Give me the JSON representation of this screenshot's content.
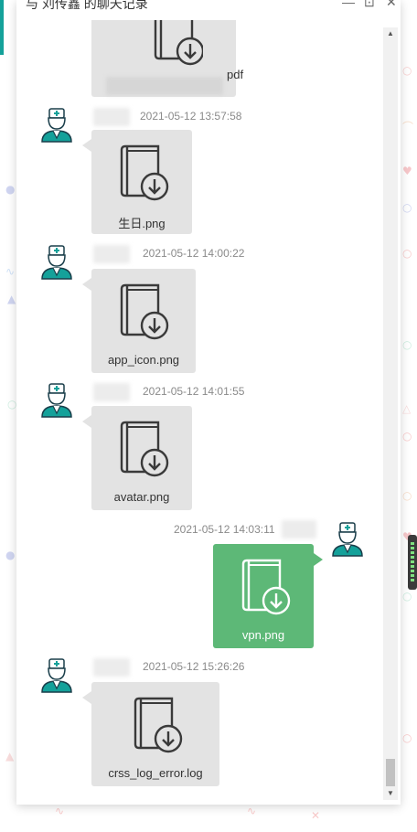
{
  "window": {
    "title": "与 刘传鑫 的聊天记录",
    "minimize_icon": "minimize-icon",
    "maximize_icon": "maximize-icon",
    "close_icon": "close-icon"
  },
  "colors": {
    "accent": "#14a19a",
    "self_bubble": "#5db877",
    "other_bubble": "#e3e3e3",
    "timestamp": "#8a8a8a"
  },
  "messages": [
    {
      "id": 0,
      "side": "left",
      "timestamp": "",
      "file_name": "pdf",
      "icon": "file-download-icon"
    },
    {
      "id": 1,
      "side": "left",
      "timestamp": "2021-05-12 13:57:58",
      "file_name": "生日.png",
      "icon": "file-download-icon"
    },
    {
      "id": 2,
      "side": "left",
      "timestamp": "2021-05-12 14:00:22",
      "file_name": "app_icon.png",
      "icon": "file-download-icon"
    },
    {
      "id": 3,
      "side": "left",
      "timestamp": "2021-05-12 14:01:55",
      "file_name": "avatar.png",
      "icon": "file-download-icon"
    },
    {
      "id": 4,
      "side": "right",
      "timestamp": "2021-05-12 14:03:11",
      "file_name": "vpn.png",
      "icon": "file-download-icon"
    },
    {
      "id": 5,
      "side": "left",
      "timestamp": "2021-05-12 15:26:26",
      "file_name": "crss_log_error.log",
      "icon": "file-download-icon"
    }
  ]
}
